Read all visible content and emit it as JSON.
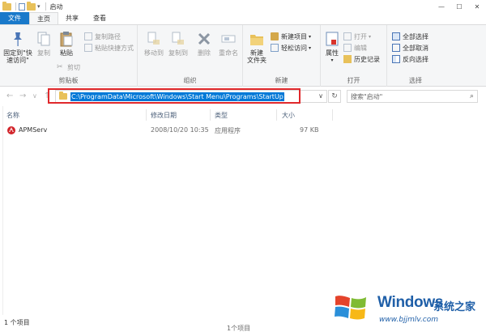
{
  "window": {
    "title": "启动",
    "controls": {
      "minimize": "—",
      "maximize": "☐",
      "close": "✕"
    }
  },
  "tabs": [
    {
      "label": "文件"
    },
    {
      "label": "主页"
    },
    {
      "label": "共享"
    },
    {
      "label": "查看"
    }
  ],
  "ribbon": {
    "clipboard": {
      "group_label": "剪贴板",
      "pin_line1": "固定到\"快",
      "pin_line2": "速访问\"",
      "copy": "复制",
      "paste": "粘贴",
      "copy_path": "复制路径",
      "paste_shortcut": "粘贴快捷方式",
      "cut": "剪切"
    },
    "organize": {
      "group_label": "组织",
      "move_to": "移动到",
      "copy_to": "复制到",
      "delete": "删除",
      "rename": "重命名"
    },
    "new": {
      "group_label": "新建",
      "new_folder_line1": "新建",
      "new_folder_line2": "文件夹",
      "new_item": "新建项目",
      "easy_access": "轻松访问"
    },
    "open": {
      "group_label": "打开",
      "properties": "属性",
      "open": "打开",
      "edit": "编辑",
      "history": "历史记录"
    },
    "select": {
      "group_label": "选择",
      "select_all": "全部选择",
      "select_none": "全部取消",
      "invert": "反向选择"
    }
  },
  "address": {
    "path": "C:\\ProgramData\\Microsoft\\Windows\\Start Menu\\Programs\\StartUp",
    "search_placeholder": "搜索\"启动\""
  },
  "columns": {
    "name": "名称",
    "modified": "修改日期",
    "type": "类型",
    "size": "大小"
  },
  "files": [
    {
      "name": "APMServ",
      "modified": "2008/10/20 10:35",
      "type": "应用程序",
      "size": "97 KB"
    }
  ],
  "status": {
    "count": "1 个项目"
  },
  "taskbar_peek": "1个项目",
  "watermark": {
    "brand": "Windows",
    "brand_cn": "系统之家",
    "url": "www.bjjmlv.com"
  },
  "colors": {
    "file_tab": "#1979ca",
    "selection": "#0078d7",
    "highlight_box": "#e0282c",
    "folder": "#e8c15a"
  }
}
